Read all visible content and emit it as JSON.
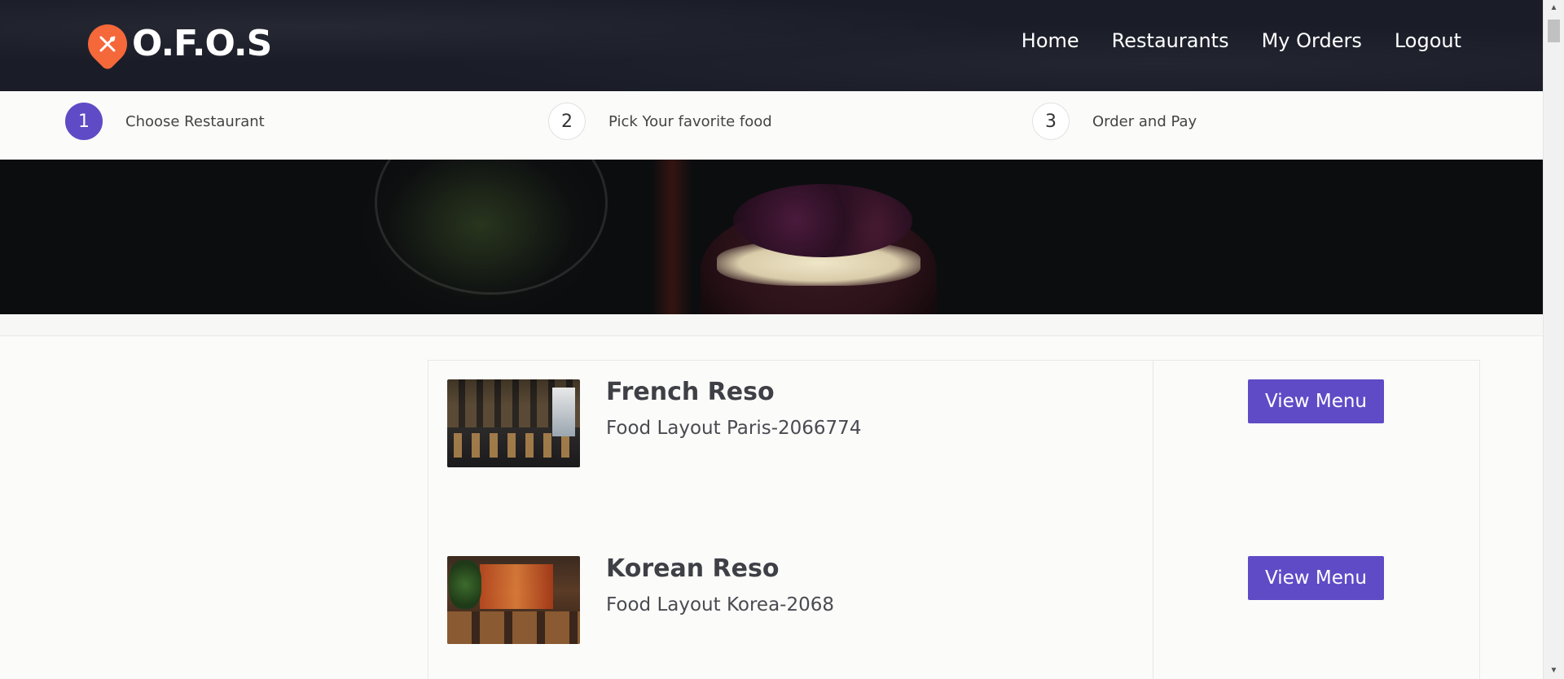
{
  "brand": {
    "name": "O.F.O.S",
    "accent": "#f4683a",
    "primary": "#5f4bc6"
  },
  "nav": {
    "items": [
      "Home",
      "Restaurants",
      "My Orders",
      "Logout"
    ]
  },
  "steps": [
    {
      "number": "1",
      "label": "Choose Restaurant",
      "active": true
    },
    {
      "number": "2",
      "label": "Pick Your favorite food",
      "active": false
    },
    {
      "number": "3",
      "label": "Order and Pay",
      "active": false
    }
  ],
  "restaurants": [
    {
      "name": "French Reso",
      "address": "Food Layout Paris-2066774",
      "button": "View Menu"
    },
    {
      "name": "Korean Reso",
      "address": "Food Layout Korea-2068",
      "button": "View Menu"
    }
  ]
}
